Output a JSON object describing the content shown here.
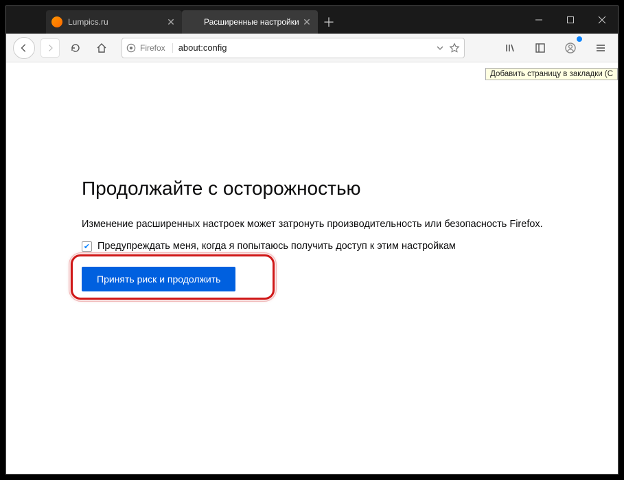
{
  "tabs": {
    "inactive_label": "Lumpics.ru",
    "active_label": "Расширенные настройки"
  },
  "urlbar": {
    "browser": "Firefox",
    "url": "about:config"
  },
  "tooltip": {
    "text": "Добавить страницу в закладки (C"
  },
  "content": {
    "title": "Продолжайте с осторожностью",
    "description": "Изменение расширенных настроек может затронуть производительность или безопасность Firefox.",
    "checkbox_label": "Предупреждать меня, когда я попытаюсь получить доступ к этим настройкам",
    "accept_button": "Принять риск и продолжить"
  }
}
